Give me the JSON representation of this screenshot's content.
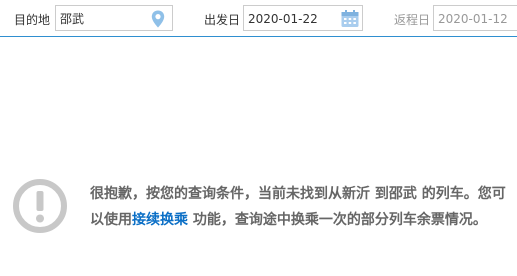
{
  "search": {
    "destination": {
      "label": "目的地",
      "value": "邵武",
      "icon": "map-pin-icon"
    },
    "depart": {
      "label": "出发日",
      "value": "2020-01-22",
      "icon": "calendar-icon"
    },
    "return": {
      "label": "返程日",
      "value": "2020-01-12"
    }
  },
  "notice": {
    "icon": "warning-circle-icon",
    "text_before": "很抱歉，按您的查询条件，当前未找到从新沂 到邵武 的列车。您可以使用",
    "link_text": "接续换乘",
    "text_after": " 功能，查询途中换乘一次的部分列车余票情况。"
  },
  "colors": {
    "accent_line": "#2f8fd0",
    "link": "#0b6fc6",
    "icon_blue": "#8fc0e8",
    "warning_gray": "#c8c8c8"
  }
}
